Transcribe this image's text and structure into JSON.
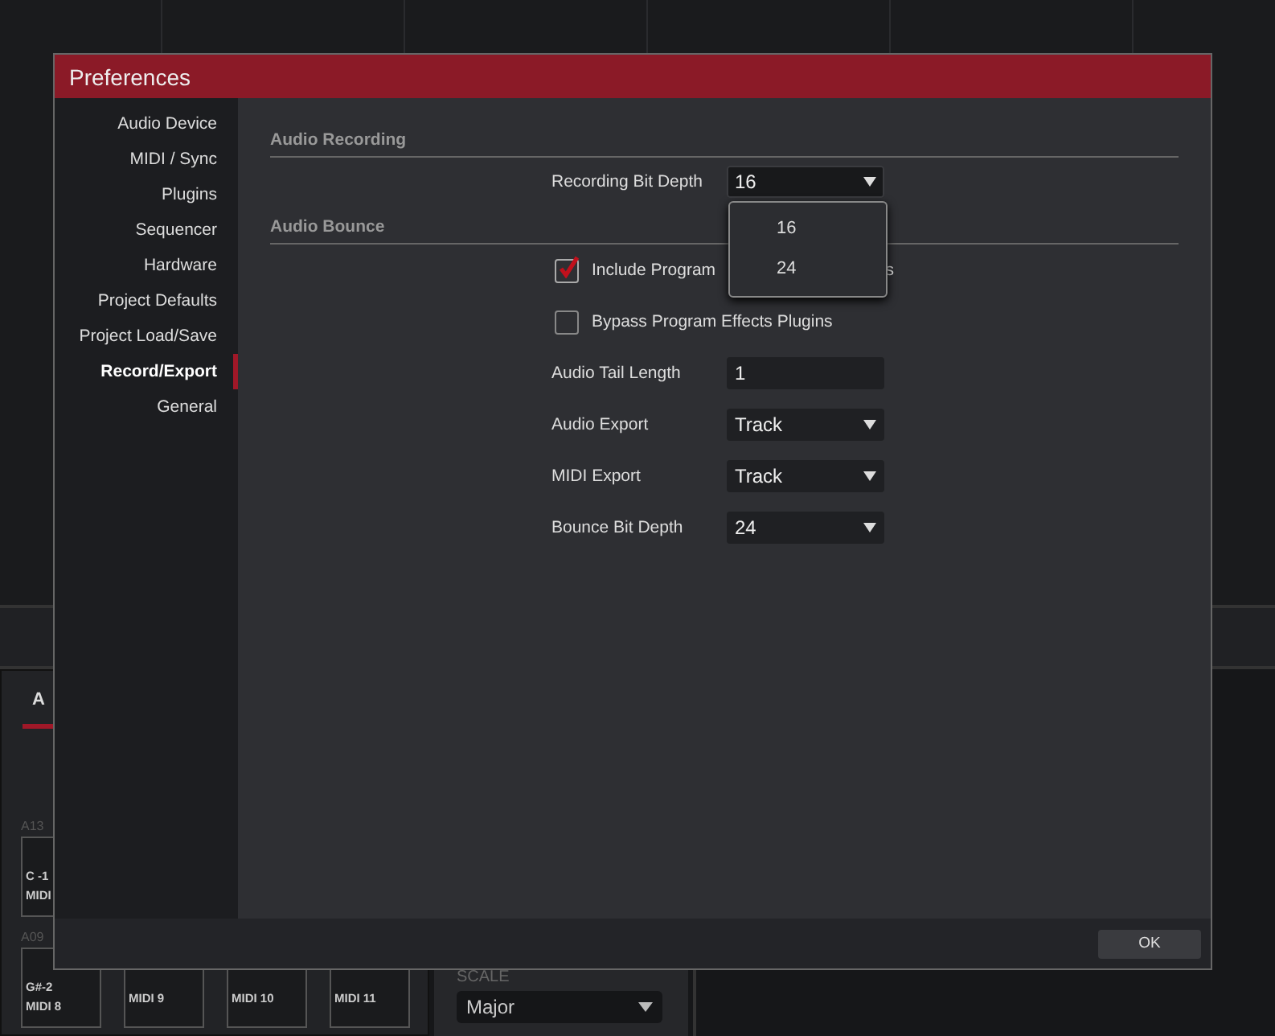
{
  "background": {
    "tabs": [
      {
        "label": "A",
        "selected": true
      }
    ],
    "pad_groups": [
      {
        "bank": "A13",
        "pads": [
          {
            "note": "C -1",
            "name": "MIDI"
          }
        ]
      },
      {
        "bank": "A09",
        "pads": [
          {
            "note": "G#-2",
            "name": "MIDI 8"
          },
          {
            "name": "MIDI 9"
          },
          {
            "name": "MIDI 10"
          },
          {
            "name": "MIDI 11"
          }
        ]
      }
    ],
    "scale": {
      "label": "SCALE",
      "value": "Major"
    }
  },
  "dialog": {
    "title": "Preferences",
    "sidebar": {
      "items": [
        {
          "label": "Audio Device",
          "selected": false
        },
        {
          "label": "MIDI / Sync",
          "selected": false
        },
        {
          "label": "Plugins",
          "selected": false
        },
        {
          "label": "Sequencer",
          "selected": false
        },
        {
          "label": "Hardware",
          "selected": false
        },
        {
          "label": "Project Defaults",
          "selected": false
        },
        {
          "label": "Project Load/Save",
          "selected": false
        },
        {
          "label": "Record/Export",
          "selected": true
        },
        {
          "label": "General",
          "selected": false
        }
      ]
    },
    "sections": [
      {
        "title": "Audio Recording",
        "rows": [
          {
            "kind": "dropdown",
            "label": "Recording Bit Depth",
            "value": "16",
            "open": true,
            "options": [
              {
                "label": "16"
              },
              {
                "label": "24"
              }
            ]
          }
        ]
      },
      {
        "title": "Audio Bounce",
        "rows": [
          {
            "kind": "checkbox",
            "label_start": "Include Program",
            "label_end": "s",
            "checked": true
          },
          {
            "kind": "checkbox",
            "label": "Bypass Program Effects Plugins",
            "checked": false
          },
          {
            "kind": "input",
            "label": "Audio Tail Length",
            "value": "1"
          },
          {
            "kind": "dropdown",
            "label": "Audio Export",
            "value": "Track",
            "open": false
          },
          {
            "kind": "dropdown",
            "label": "MIDI Export",
            "value": "Track",
            "open": false
          },
          {
            "kind": "dropdown",
            "label": "Bounce Bit Depth",
            "value": "24",
            "open": false
          }
        ]
      }
    ],
    "buttons": [
      "OK"
    ]
  }
}
